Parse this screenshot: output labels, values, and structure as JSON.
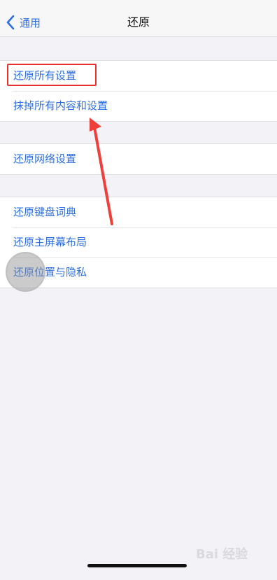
{
  "nav": {
    "back_label": "通用",
    "title": "还原"
  },
  "groups": [
    {
      "items": [
        {
          "label": "还原所有设置"
        },
        {
          "label": "抹掉所有内容和设置"
        }
      ]
    },
    {
      "items": [
        {
          "label": "还原网络设置"
        }
      ]
    },
    {
      "items": [
        {
          "label": "还原键盘词典"
        },
        {
          "label": "还原主屏幕布局"
        },
        {
          "label": "还原位置与隐私"
        }
      ]
    }
  ],
  "watermark": {
    "text": "Bai 经验"
  },
  "colors": {
    "accent": "#2f6fe0",
    "highlight": "#e8302e",
    "background": "#f2f2f7"
  }
}
